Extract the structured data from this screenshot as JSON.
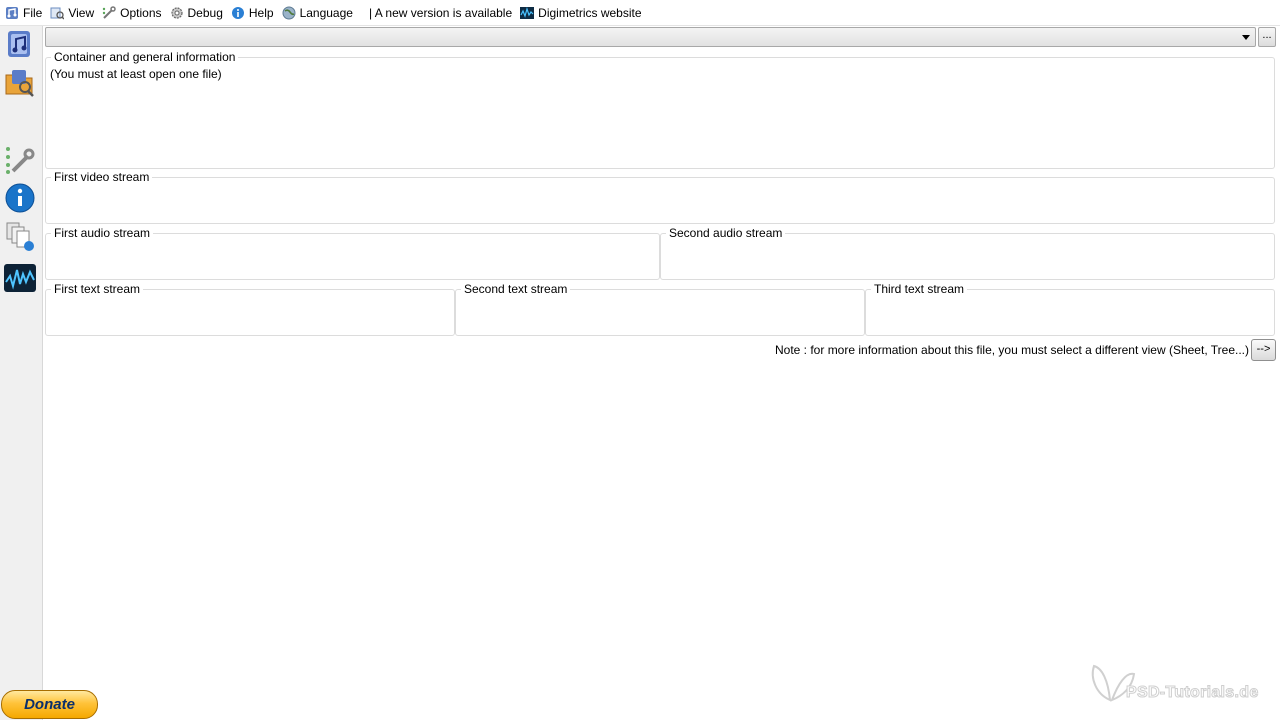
{
  "menu": {
    "items": [
      {
        "label": "File",
        "icon": "mediainfo-app-icon"
      },
      {
        "label": "View",
        "icon": "view-icon"
      },
      {
        "label": "Options",
        "icon": "options-icon"
      },
      {
        "label": "Debug",
        "icon": "debug-gear-icon"
      },
      {
        "label": "Help",
        "icon": "help-icon"
      },
      {
        "label": "Language",
        "icon": "language-globe-icon"
      }
    ],
    "new_version": "| A new version is available",
    "website": "Digimetrics website"
  },
  "file_selector": {
    "value": "",
    "browse_label": "..."
  },
  "sections": {
    "general": {
      "legend": "Container and general information",
      "content": "(You must at least open one file)"
    },
    "video1": {
      "legend": "First video stream"
    },
    "audio1": {
      "legend": "First audio stream"
    },
    "audio2": {
      "legend": "Second audio stream"
    },
    "text1": {
      "legend": "First text stream"
    },
    "text2": {
      "legend": "Second text stream"
    },
    "text3": {
      "legend": "Third text stream"
    }
  },
  "note": {
    "text": "Note : for more information about this file, you must select a different view (Sheet, Tree...)",
    "next_label": "-->"
  },
  "donate": {
    "label": "Donate"
  },
  "toolbar": {
    "icons": [
      "open-file-icon",
      "open-folder-icon",
      "preferences-icon",
      "info-icon",
      "export-icon",
      "waveform-icon"
    ]
  },
  "watermark": {
    "text": "PSD-Tutorials.de"
  },
  "colors": {
    "accent_blue": "#1a74c9",
    "donate_gold": "#ffc33a"
  }
}
